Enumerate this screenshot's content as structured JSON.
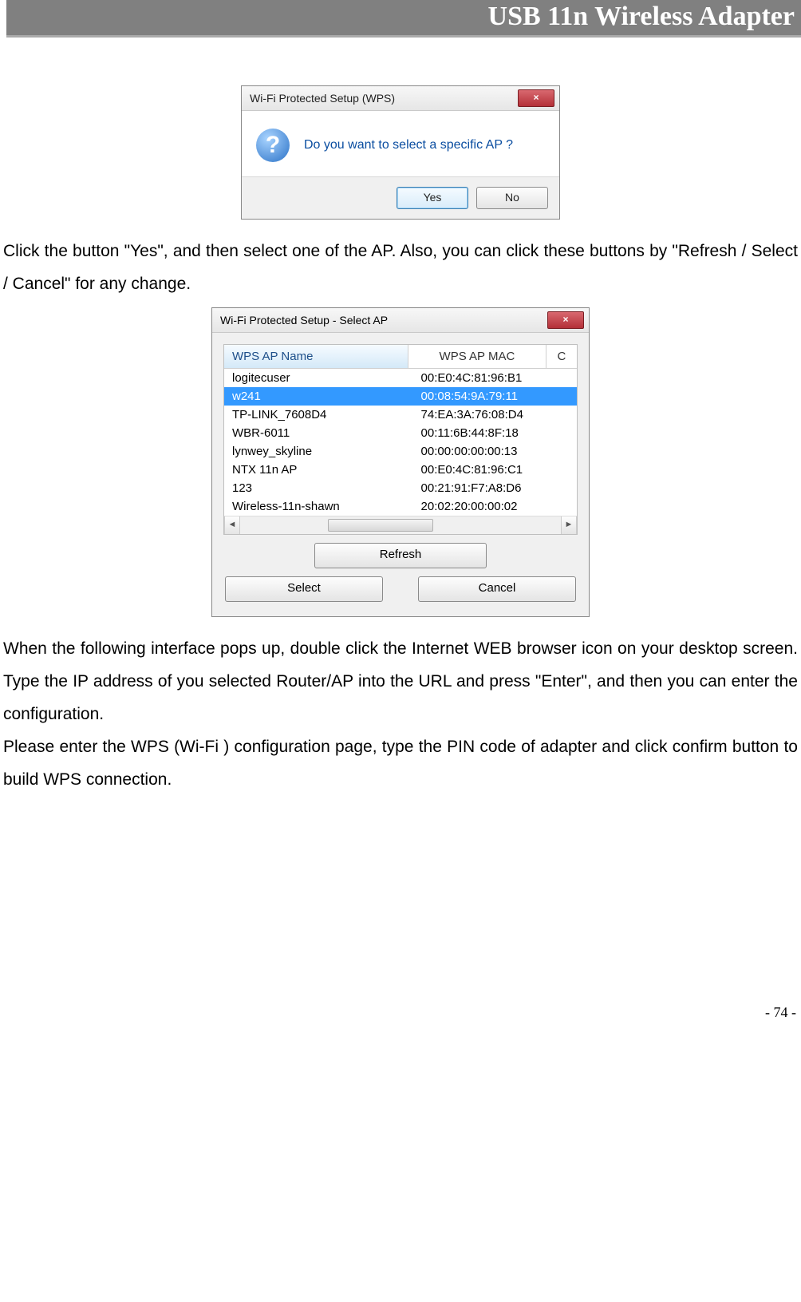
{
  "header_title": "USB 11n Wireless Adapter",
  "dlg1": {
    "title": "Wi-Fi Protected Setup (WPS)",
    "close_glyph": "×",
    "icon_glyph": "?",
    "message": "Do you want to select a specific AP ?",
    "yes_label": "Yes",
    "no_label": "No"
  },
  "para1": "Click the button \"Yes\", and then select one of the AP. Also, you can click these buttons by \"Refresh / Select / Cancel\" for any change.",
  "dlg2": {
    "title": "Wi-Fi Protected Setup - Select AP",
    "close_glyph": "×",
    "col_name": "WPS AP Name",
    "col_mac": "WPS AP MAC",
    "col3": "C",
    "rows": [
      {
        "name": "logitecuser",
        "mac": "00:E0:4C:81:96:B1",
        "selected": false
      },
      {
        "name": "w241",
        "mac": "00:08:54:9A:79:11",
        "selected": true
      },
      {
        "name": "TP-LINK_7608D4",
        "mac": "74:EA:3A:76:08:D4",
        "selected": false
      },
      {
        "name": "WBR-6011",
        "mac": "00:11:6B:44:8F:18",
        "selected": false
      },
      {
        "name": "lynwey_skyline",
        "mac": "00:00:00:00:00:13",
        "selected": false
      },
      {
        "name": "NTX 11n AP",
        "mac": "00:E0:4C:81:96:C1",
        "selected": false
      },
      {
        "name": "123",
        "mac": "00:21:91:F7:A8:D6",
        "selected": false
      },
      {
        "name": "Wireless-11n-shawn",
        "mac": "20:02:20:00:00:02",
        "selected": false
      }
    ],
    "refresh_label": "Refresh",
    "select_label": "Select",
    "cancel_label": "Cancel",
    "scroll_left_glyph": "◄",
    "scroll_right_glyph": "►"
  },
  "para2": "When the following interface pops up, double click the Internet WEB browser icon on your desktop screen. Type the IP address of you selected Router/AP into the URL and press \"Enter\", and then you can enter the configuration.",
  "para3": "Please enter the WPS (Wi-Fi ) configuration page, type the PIN code of adapter and click confirm button to build WPS connection.",
  "page_number": "- 74 -"
}
